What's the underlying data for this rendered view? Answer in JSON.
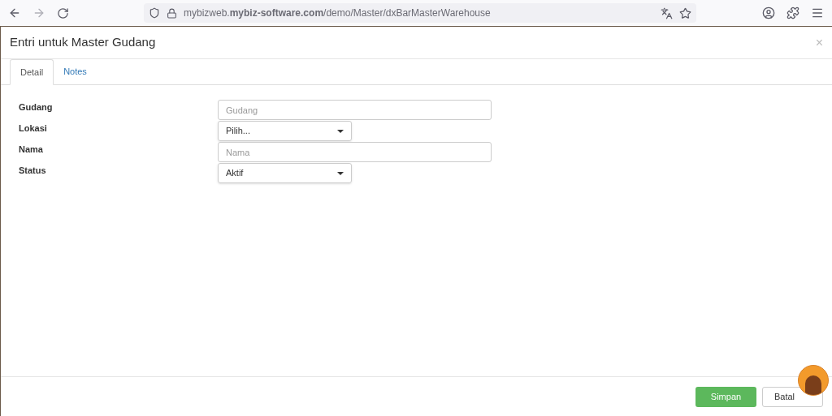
{
  "browser": {
    "url": "mybizweb.**mybiz-software.com**/demo/Master/dxBarMasterWarehouse"
  },
  "dialog": {
    "title": "Entri untuk Master Gudang",
    "close": "×"
  },
  "tabs": [
    {
      "label": "Detail",
      "selected": true
    },
    {
      "label": "Notes",
      "selected": false
    }
  ],
  "fields": [
    {
      "label": "Gudang",
      "kind": "text",
      "placeholder": "Gudang"
    },
    {
      "label": "Lokasi",
      "kind": "select",
      "value": "Pilih..."
    },
    {
      "label": "Nama",
      "kind": "text",
      "placeholder": "Nama"
    },
    {
      "label": "Status",
      "kind": "select",
      "value": "Aktif"
    }
  ],
  "buttons": [
    {
      "label": "Simpan",
      "kind": "primary"
    },
    {
      "label": "Batal",
      "kind": "default"
    }
  ]
}
